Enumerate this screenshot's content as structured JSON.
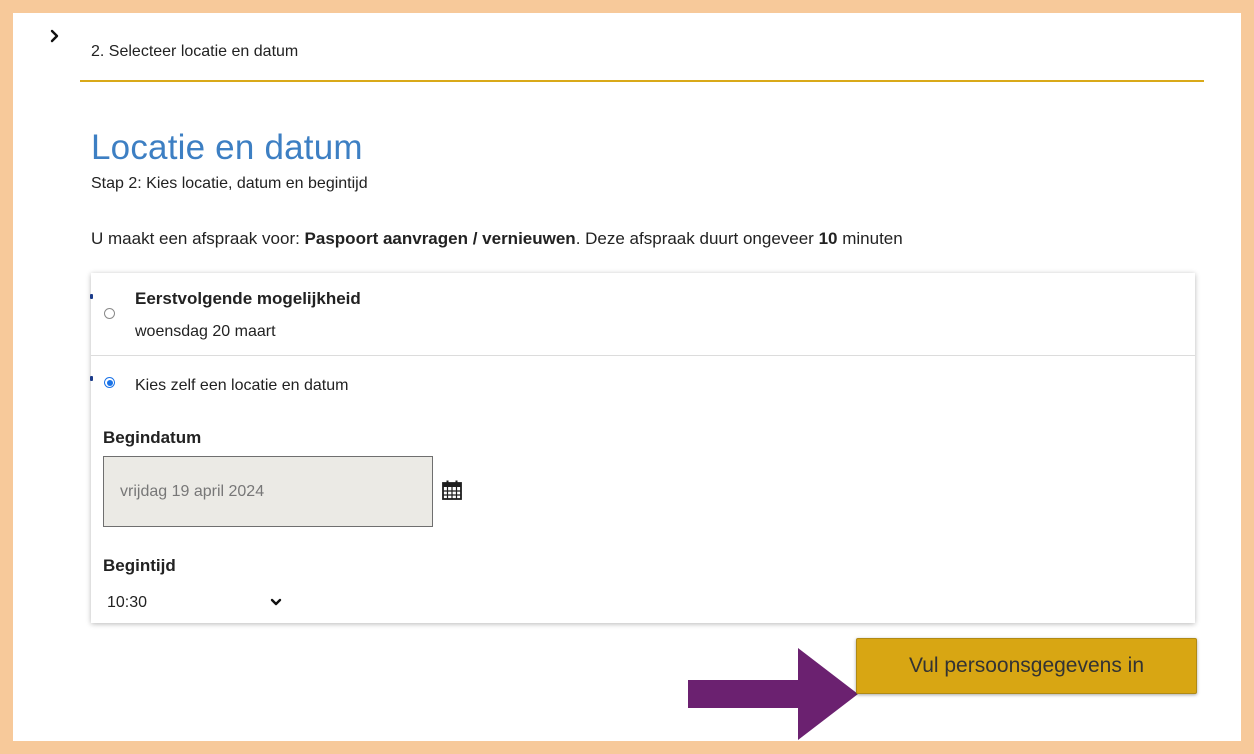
{
  "header": {
    "step_label": "2. Selecteer locatie en datum"
  },
  "page": {
    "title": "Locatie en datum",
    "subtitle": "Stap 2: Kies locatie, datum en begintijd",
    "info": {
      "prefix": "U maakt een afspraak voor: ",
      "service": "Paspoort aanvragen / vernieuwen",
      "middle": ". Deze afspraak duurt ongeveer ",
      "duration": "10",
      "suffix": " minuten"
    }
  },
  "options": {
    "first_available": {
      "title": "Eerstvolgende mogelijkheid",
      "date": "woensdag 20 maart",
      "selected": false
    },
    "choose_own": {
      "label": "Kies zelf een locatie en datum",
      "selected": true
    }
  },
  "form": {
    "start_date_label": "Begindatum",
    "start_date_value": "vrijdag 19 april 2024",
    "start_time_label": "Begintijd",
    "start_time_value": "10:30"
  },
  "actions": {
    "submit_label": "Vul persoonsgegevens in"
  },
  "colors": {
    "frame": "#f7c99a",
    "accent_line": "#d9a919",
    "title_blue": "#3d7fc3",
    "button": "#d8a613",
    "arrow": "#6b2170",
    "radio_selected": "#1a73e8"
  },
  "icons": {
    "step_chevron": "chevron-right-icon",
    "calendar": "calendar-icon",
    "time_dropdown": "chevron-down-icon",
    "annotation_arrow": "arrow-right-icon"
  }
}
